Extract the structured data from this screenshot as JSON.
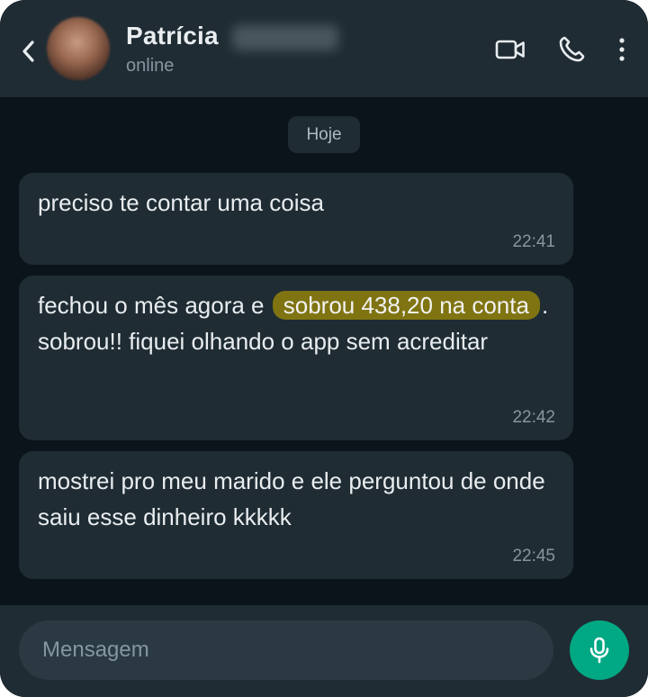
{
  "header": {
    "contact_name": "Patrícia",
    "status": "online",
    "icons": {
      "back": "chevron-left-icon",
      "video": "video-camera-icon",
      "call": "phone-icon",
      "menu": "more-vertical-icon"
    }
  },
  "chat": {
    "date_label": "Hoje",
    "messages": [
      {
        "text": "preciso te contar uma coisa",
        "time": "22:41"
      },
      {
        "text_before": "fechou o mês agora e",
        "highlight": "sobrou 438,20 na conta",
        "text_after": ". sobrou!! fiquei olhando o app sem acreditar",
        "time": "22:42"
      },
      {
        "text": "mostrei pro meu marido e ele perguntou de onde saiu esse dinheiro kkkkk",
        "time": "22:45"
      }
    ]
  },
  "composer": {
    "placeholder": "Mensagem",
    "mic_icon": "microphone-icon"
  },
  "colors": {
    "header_bg": "#1f2c34",
    "chat_bg": "#0b141a",
    "bubble_bg": "#1f2c34",
    "highlight": "#7f7411",
    "accent": "#00a884"
  }
}
